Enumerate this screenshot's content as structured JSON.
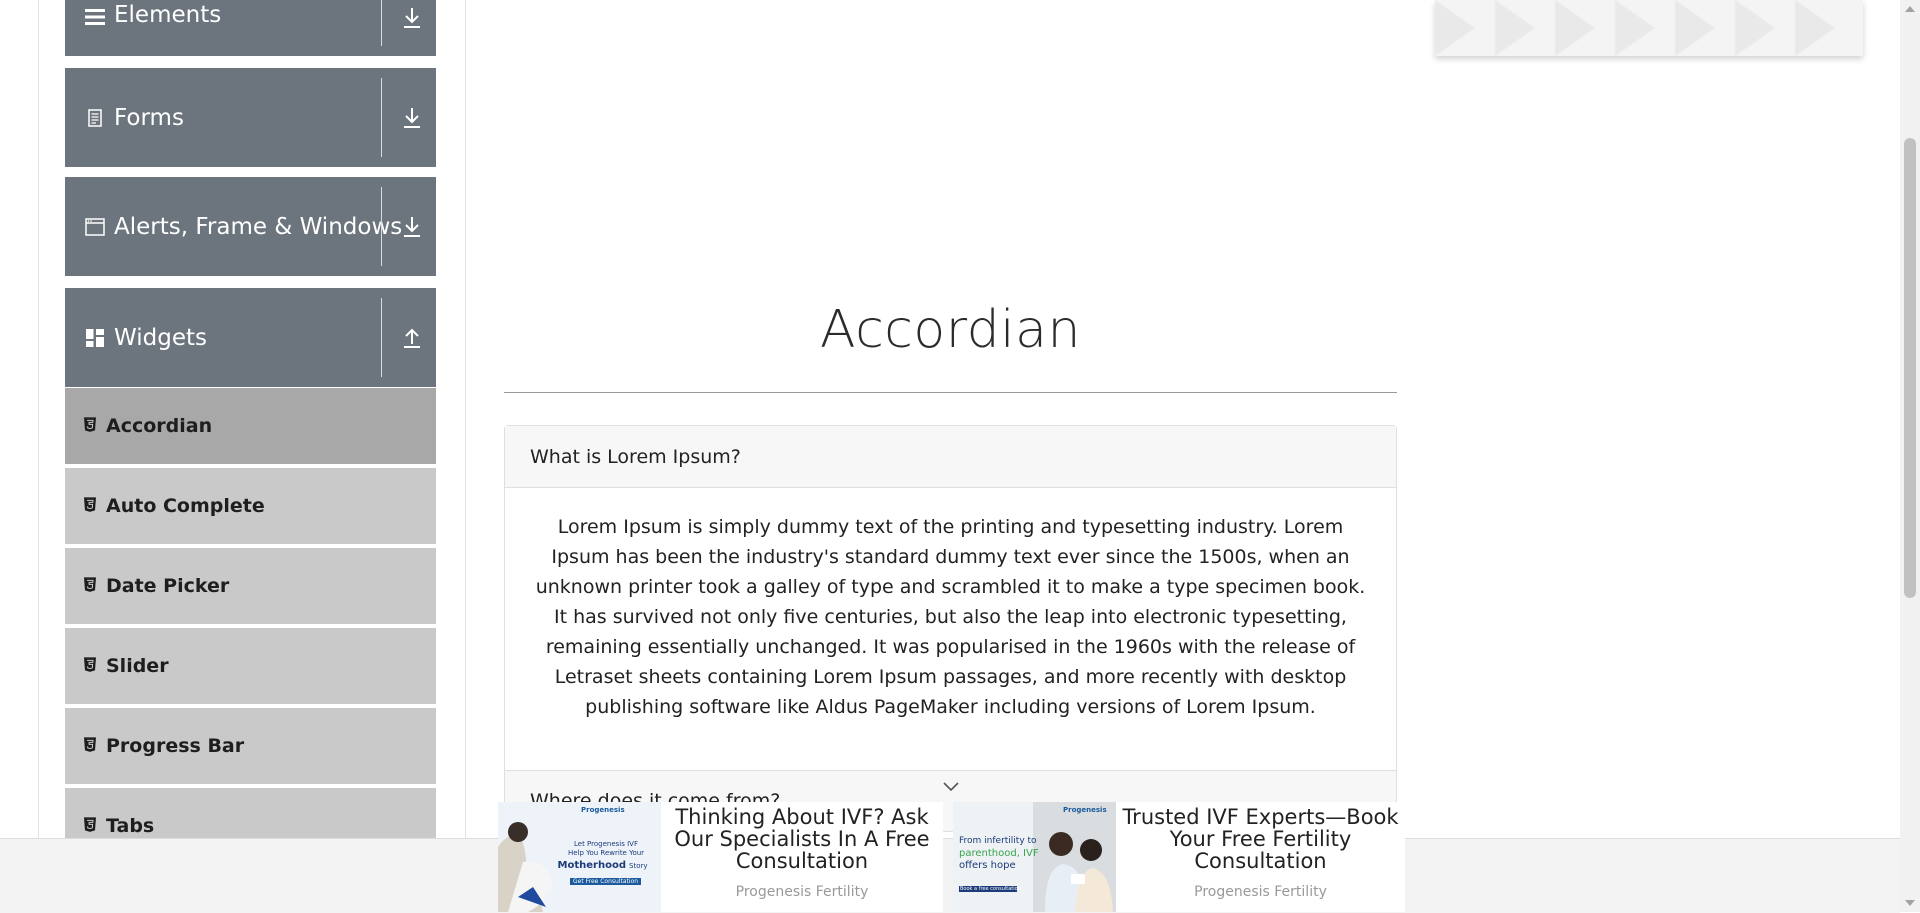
{
  "sidebar": {
    "groups": [
      {
        "label": "Elements",
        "icon": "list-icon",
        "state": "collapsed"
      },
      {
        "label": "Forms",
        "icon": "document-icon",
        "state": "collapsed"
      },
      {
        "label": "Alerts, Frame & Windows",
        "icon": "window-icon",
        "state": "collapsed"
      },
      {
        "label": "Widgets",
        "icon": "widgets-icon",
        "state": "expanded"
      }
    ],
    "widget_items": [
      {
        "label": "Accordian",
        "active": true
      },
      {
        "label": "Auto Complete"
      },
      {
        "label": "Date Picker"
      },
      {
        "label": "Slider"
      },
      {
        "label": "Progress Bar"
      },
      {
        "label": "Tabs"
      }
    ]
  },
  "main": {
    "title": "Accordian",
    "accordion": [
      {
        "header": "What is Lorem Ipsum?",
        "body": "Lorem Ipsum is simply dummy text of the printing and typesetting industry. Lorem Ipsum has been the industry's standard dummy text ever since the 1500s, when an unknown printer took a galley of type and scrambled it to make a type specimen book. It has survived not only five centuries, but also the leap into electronic typesetting, remaining essentially unchanged. It was popularised in the 1960s with the release of Letraset sheets containing Lorem Ipsum passages, and more recently with desktop publishing software like Aldus PageMaker including versions of Lorem Ipsum."
      },
      {
        "header": "Where does it come from?"
      }
    ]
  },
  "ads": [
    {
      "headline": "Thinking About IVF? Ask Our Specialists In A Free Consultation",
      "brand": "Progenesis Fertility",
      "image_text": {
        "logo": "Progenesis",
        "line1": "Let Progenesis IVF",
        "line2": "Help You Rewrite Your",
        "line3": "Motherhood",
        "line4": "Story",
        "cta": "Get Free Consultation"
      }
    },
    {
      "headline": "Trusted IVF Experts—Book Your Free Fertility Consultation",
      "brand": "Progenesis Fertility",
      "image_text": {
        "logo": "Progenesis",
        "line1": "From infertility to",
        "line2": "parenthood, IVF",
        "line3": "offers hope",
        "cta": "Book a free consultation"
      }
    }
  ],
  "colors": {
    "group_bg": "#6c757d",
    "sub_item_bg": "#c9c9c9",
    "sub_item_active_bg": "#a8a8a8"
  }
}
